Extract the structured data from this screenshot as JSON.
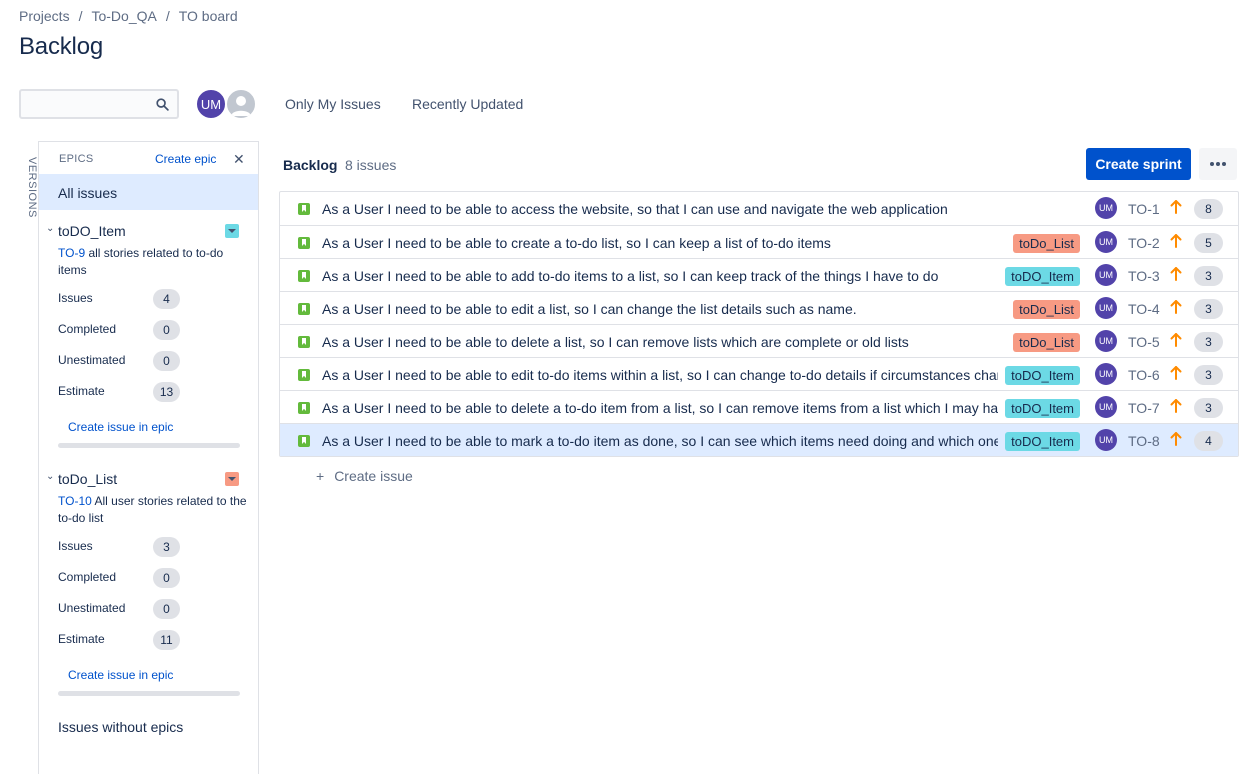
{
  "breadcrumb": [
    "Projects",
    "To-Do_QA",
    "TO board"
  ],
  "breadcrumb_separator": "/",
  "page_title": "Backlog",
  "search": {
    "value": "",
    "placeholder": ""
  },
  "avatars": {
    "current_user_initials": "UM"
  },
  "quick_filters": [
    "Only My Issues",
    "Recently Updated"
  ],
  "sidebar": {
    "versions_tab": "VERSIONS",
    "epics_header": "EPICS",
    "create_epic": "Create epic",
    "close_label": "✕",
    "all_issues": "All issues",
    "epics": [
      {
        "name": "toDO_Item",
        "color": "#6cd9e5",
        "key": "TO-9",
        "description": " all stories related to to-do items",
        "stats": [
          {
            "label": "Issues",
            "value": "4"
          },
          {
            "label": "Completed",
            "value": "0"
          },
          {
            "label": "Unestimated",
            "value": "0"
          },
          {
            "label": "Estimate",
            "value": "13"
          }
        ],
        "create_issue": "Create issue in epic",
        "progress": 0
      },
      {
        "name": "toDo_List",
        "color": "#f79a83",
        "key": "TO-10",
        "description": " All user stories related to the to-do list",
        "stats": [
          {
            "label": "Issues",
            "value": "3"
          },
          {
            "label": "Completed",
            "value": "0"
          },
          {
            "label": "Unestimated",
            "value": "0"
          },
          {
            "label": "Estimate",
            "value": "11"
          }
        ],
        "create_issue": "Create issue in epic",
        "progress": 0
      }
    ],
    "issues_without_epics": "Issues without epics"
  },
  "backlog": {
    "title": "Backlog",
    "count": "8 issues",
    "create_sprint": "Create sprint",
    "create_issue": "Create issue",
    "issues": [
      {
        "summary": "As a User I need to be able to access the website, so that I can use and navigate the web application",
        "epic": "",
        "assignee": "UM",
        "key": "TO-1",
        "points": "8"
      },
      {
        "summary": "As a User I need to be able to create a to-do list, so I can keep a list of to-do items",
        "epic": "toDo_List",
        "assignee": "UM",
        "key": "TO-2",
        "points": "5"
      },
      {
        "summary": "As a User I need to be able to add to-do items to a list, so I can keep track of the things I have to do",
        "epic": "toDO_Item",
        "assignee": "UM",
        "key": "TO-3",
        "points": "3"
      },
      {
        "summary": "As a User I need to be able to edit a list, so I can change the list details such as name.",
        "epic": "toDo_List",
        "assignee": "UM",
        "key": "TO-4",
        "points": "3"
      },
      {
        "summary": "As a User I need to be able to delete a list, so I can remove lists which are complete or old lists",
        "epic": "toDo_List",
        "assignee": "UM",
        "key": "TO-5",
        "points": "3"
      },
      {
        "summary": "As a User I need to be able to edit to-do items within a list, so I can change to-do details if circumstances change",
        "epic": "toDO_Item",
        "assignee": "UM",
        "key": "TO-6",
        "points": "3"
      },
      {
        "summary": "As a User I need to be able to delete a to-do item from a list, so I can remove items from a list which I may have",
        "epic": "toDO_Item",
        "assignee": "UM",
        "key": "TO-7",
        "points": "3"
      },
      {
        "summary": "As a User I need to be able to mark a to-do item as done, so I can see which items need doing and which ones",
        "epic": "toDO_Item",
        "assignee": "UM",
        "key": "TO-8",
        "points": "4",
        "selected": true
      }
    ]
  },
  "colors": {
    "accent": "#0052cc",
    "selected_row": "#deebff",
    "avatar": "#5243aa",
    "priority": "#ff8b00",
    "story": "#63ba3c"
  }
}
